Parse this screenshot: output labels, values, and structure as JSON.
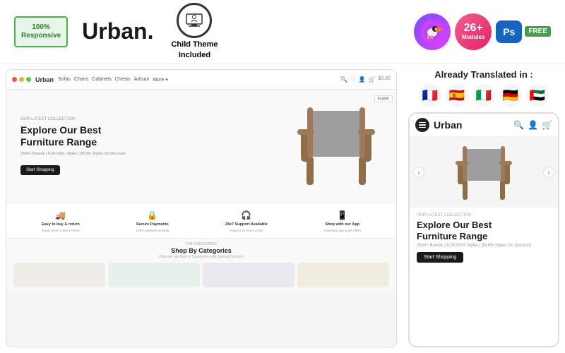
{
  "header": {
    "responsive_badge_line1": "100%",
    "responsive_badge_line2": "Responsive",
    "brand_name": "Urban.",
    "child_theme_label": "Child Theme",
    "child_theme_sub": "Included",
    "modules_count": "26+",
    "modules_label": "Modules",
    "ps_label": "Ps",
    "free_label": "FREE"
  },
  "translated_section": {
    "label": "Already Translated in :"
  },
  "desktop_preview": {
    "nav_logo": "Urban",
    "nav_items": [
      "Sofas",
      "Chairs",
      "Cabinets",
      "Chests",
      "Artisan",
      "More"
    ],
    "hero_collection": "OUR LATEST COLLECTION",
    "hero_title_line1": "Explore Our Best",
    "hero_title_line2": "Furniture Range",
    "hero_subtitle": "2500+ Brands | 6,00,000+ Styles | 99.9% Styles On Discount",
    "hero_btn": "Start Shopping",
    "lang": "English",
    "features": [
      {
        "icon": "🚚",
        "label": "Easy to buy & return",
        "sub": "Single price to buy & return"
      },
      {
        "icon": "🔒",
        "label": "Secure Payments",
        "sub": "100% payment security"
      },
      {
        "icon": "🎧",
        "label": "24x7 Support Available",
        "sub": "Support 24 hours a day"
      },
      {
        "icon": "📱",
        "label": "Shop with our App",
        "sub": "Download app & get offers"
      }
    ],
    "categories_sub": "THE CATEGORIES",
    "categories_title": "Shop By Categories",
    "categories_desc": "Discover our Best of Categories with Special Discount"
  },
  "mobile_preview": {
    "logo": "Urban",
    "collection_label": "OUR LATEST COLLECTION",
    "hero_title_line1": "Explore Our Best",
    "hero_title_line2": "Furniture Range",
    "hero_sub": "2500+ Brands | 6,00,000+ Styles | 99.9% Styles On Discount",
    "btn_label": "Start Shopping"
  },
  "flags": [
    "🇫🇷",
    "🇪🇸",
    "🇮🇹",
    "🇩🇪",
    "🇦🇪"
  ]
}
